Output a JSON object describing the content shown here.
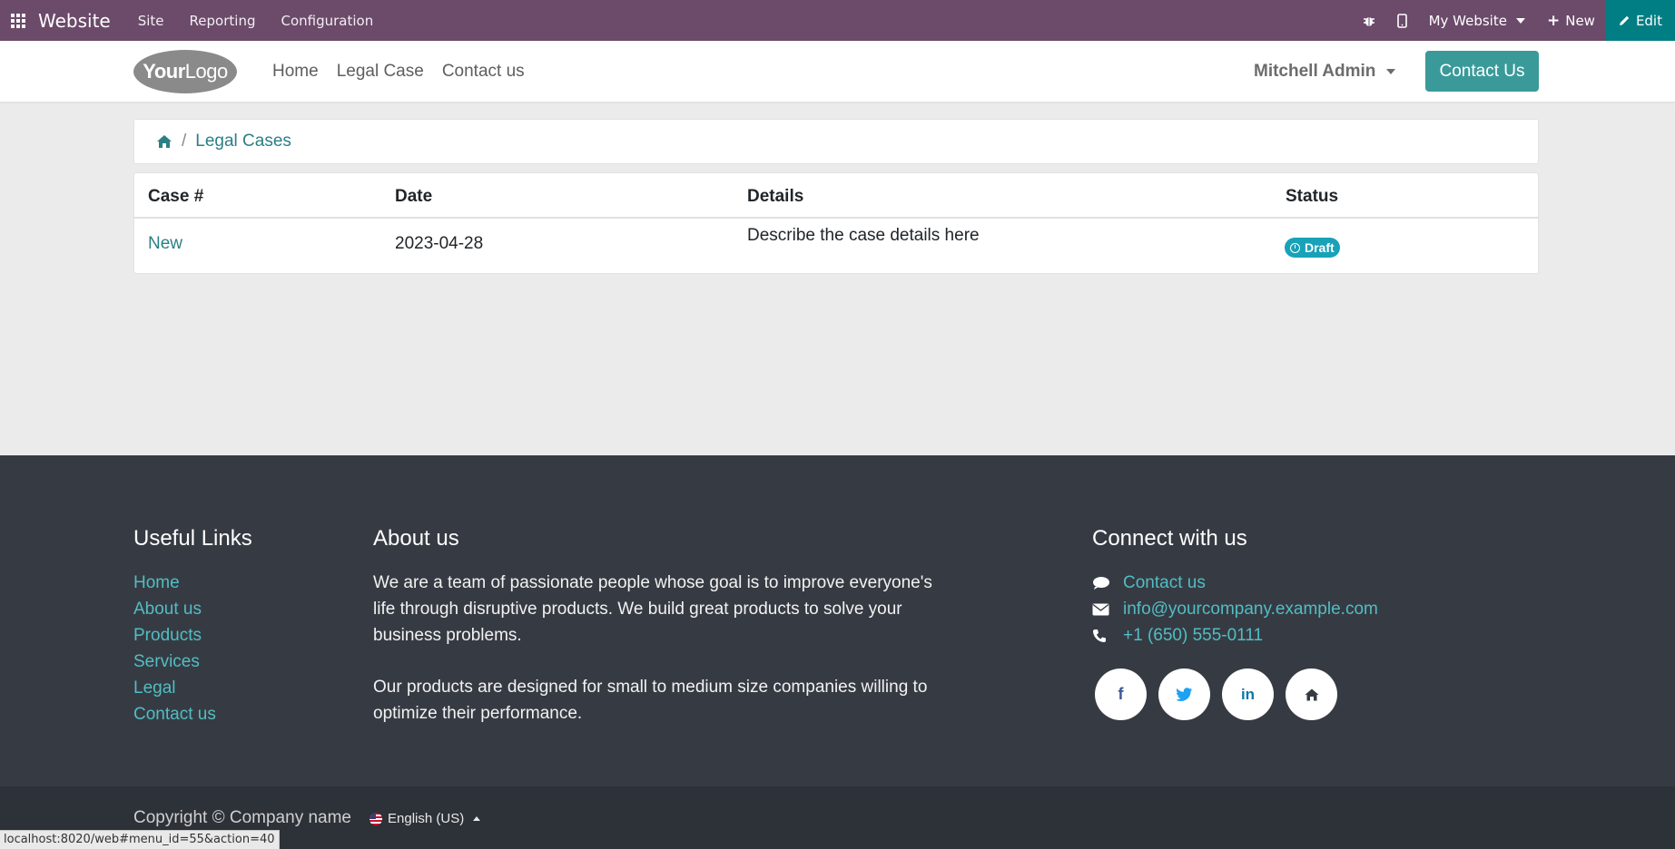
{
  "topbar": {
    "brand": "Website",
    "menus": [
      "Site",
      "Reporting",
      "Configuration"
    ],
    "website_selector": "My Website",
    "new_label": "New",
    "edit_label": "Edit"
  },
  "header": {
    "logo_text_bold": "Your",
    "logo_text": "Logo",
    "nav": [
      "Home",
      "Legal Case",
      "Contact us"
    ],
    "user": "Mitchell Admin",
    "cta": "Contact Us"
  },
  "breadcrumb": {
    "current": "Legal Cases"
  },
  "table": {
    "columns": [
      "Case #",
      "Date",
      "Details",
      "Status"
    ],
    "rows": [
      {
        "case": "New",
        "date": "2023-04-28",
        "details": "Describe the case details here",
        "status": "Draft"
      }
    ]
  },
  "footer": {
    "useful_links_title": "Useful Links",
    "useful_links": [
      "Home",
      "About us",
      "Products",
      "Services",
      "Legal",
      "Contact us"
    ],
    "about_title": "About us",
    "about_p1": "We are a team of passionate people whose goal is to improve everyone's life through disruptive products. We build great products to solve your business problems.",
    "about_p2": "Our products are designed for small to medium size companies willing to optimize their performance.",
    "connect_title": "Connect with us",
    "contact_link": "Contact us",
    "email": "info@yourcompany.example.com",
    "phone": "+1 (650) 555-0111",
    "socials": [
      "facebook-icon",
      "twitter-icon",
      "linkedin-icon",
      "home-icon"
    ],
    "copyright": "Copyright © Company name",
    "language": "English (US)"
  },
  "statusbar": "localhost:8020/web#menu_id=55&action=40",
  "colors": {
    "topbar": "#6b4a6a",
    "accent": "#017e84",
    "cta": "#3a9a99",
    "footer": "#363b43",
    "footer_link": "#52bdc3",
    "badge": "#17a2b8"
  }
}
